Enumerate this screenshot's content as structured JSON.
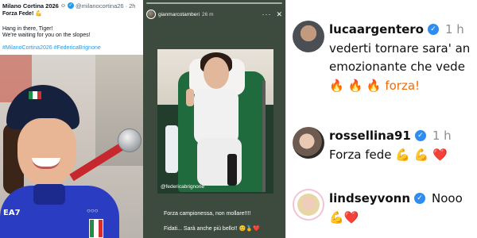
{
  "tweet": {
    "account_name": "Milano Cortina 2026",
    "account_emoji": "☺",
    "handle": "@milanocortina26",
    "time": "2h",
    "headline": "Forza Fede! 💪",
    "line1": "Hang in there, Tiger!",
    "line2": "We're waiting for you on the slopes!",
    "hashtags": "#MilanoCortina2026 #FedericaBrignone",
    "photo_text_left": "EA7",
    "photo_rings": "○○○"
  },
  "story": {
    "username": "gianmarcotamberi",
    "time": "26 m",
    "menu_icon": "more-icon",
    "close_icon": "close-icon",
    "mention": "@federicabrignone",
    "caption1": "Forza campionessa, non mollare!!!!",
    "caption2": "Fidati... Sarà anche più bello!! 😊🏅❤️"
  },
  "comments": [
    {
      "user": "lucaargentero",
      "time": "1 h",
      "lines": [
        "vederti tornare sara' an",
        "emozionante che vede"
      ],
      "extra": "🔥 🔥 🔥 forza!"
    },
    {
      "user": "rossellina91",
      "time": "1 h",
      "lines": [
        "Forza fede 💪 💪 ❤️"
      ],
      "extra": ""
    },
    {
      "user": "lindseyvonn",
      "time": "",
      "lines": [
        "Nooo"
      ],
      "extra": "💪❤️"
    }
  ],
  "colors": {
    "twitter_blue": "#1d9bf0",
    "ig_verified": "#2f8cf0",
    "heart": "#e0143b",
    "fire": "#f56a00"
  }
}
